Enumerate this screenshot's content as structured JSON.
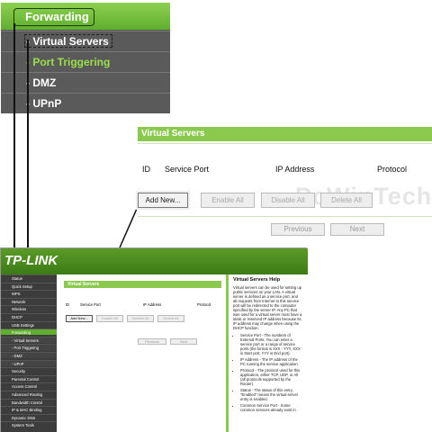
{
  "menu": {
    "forwarding": "Forwarding",
    "items": [
      "- Virtual Servers",
      "- Port Triggering",
      "- DMZ",
      "- UPnP"
    ]
  },
  "zoom": {
    "title": "Virtual Servers",
    "headers": [
      "ID",
      "Service Port",
      "IP Address",
      "Protocol"
    ],
    "buttons": [
      "Add New...",
      "Enable All",
      "Disable All",
      "Delete All"
    ],
    "nav": [
      "Previous",
      "Next"
    ],
    "watermark": "PcWinTech.com"
  },
  "full": {
    "logo": "TP-LINK",
    "sidebar": [
      "Status",
      "Quick Setup",
      "WPS",
      "Network",
      "Wireless",
      "DHCP",
      "USB Settings",
      "Forwarding",
      "- Virtual Servers",
      "- Port Triggering",
      "- DMZ",
      "- UPnP",
      "Security",
      "Parental Control",
      "Access Control",
      "Advanced Routing",
      "Bandwidth Control",
      "IP & MAC Binding",
      "Dynamic DNS",
      "System Tools"
    ],
    "main_title": "Virtual Servers",
    "headers": [
      "ID",
      "Service Port",
      "IP Address",
      "Protocol"
    ],
    "buttons": [
      "Add New...",
      "Enable All",
      "Disable All",
      "Delete All"
    ],
    "nav": [
      "Previous",
      "Next"
    ],
    "help_title": "Virtual Servers Help",
    "help_intro": "Virtual servers can be used for setting up public services on your LAN. A virtual server is defined as a service port, and all requests from Internet to this service port will be redirected to the computer specified by the server IP. Any PC that was used for a virtual server must have a static or reserved IP address because its IP address may change when using the DHCP function.",
    "help_items": [
      "Service Port - The numbers of External Ports. You can enter a service port or a range of service ports (the format is XXX - YYY, XXX is Start port, YYY is End port).",
      "IP Address - The IP address of the PC running the service application.",
      "Protocol - The protocol used for this application, either TCP, UDP, or All (all protocols supported by the Router).",
      "Status - The status of this entry, \"Enabled\" means the virtual server entry is enabled.",
      "Common Service Port - Some common services already exist in"
    ]
  }
}
